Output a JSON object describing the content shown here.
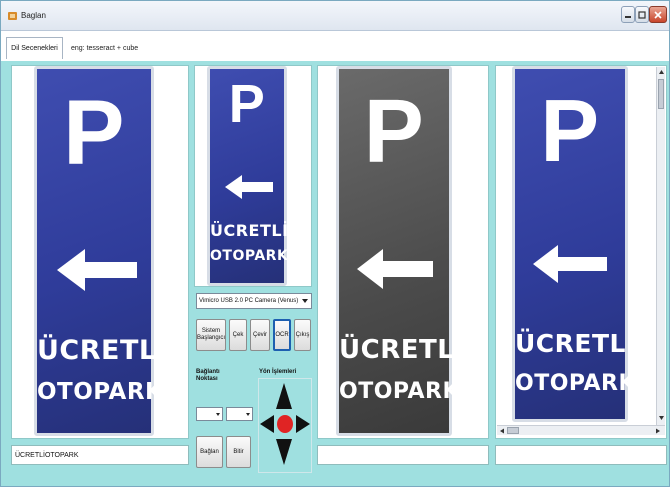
{
  "window": {
    "title": "Baglan"
  },
  "tabs": [
    {
      "label": "Dil Secenekleri"
    }
  ],
  "engine_label": "eng: tesseract + cube",
  "sign": {
    "line1": "P",
    "line2": "ÜCRETLİ",
    "line3": "OTOPARK"
  },
  "camera_select": {
    "value": "Vimicro USB 2.0 PC Camera (Venus)"
  },
  "buttons": {
    "system_start": {
      "line1": "Sistem",
      "line2": "Başlangıcı"
    },
    "capture": "Çek",
    "rotate": "Çevir",
    "ocr": "OCR",
    "exit": "Çıkış",
    "connect": "Bağlan",
    "finish": "Bitir"
  },
  "connection_group": {
    "line1": "Bağlantı",
    "line2": "Noktası"
  },
  "direction_group": {
    "label": "Yön İşlemleri"
  },
  "ocr_result": "ÜCRETLİOTOPARK",
  "colors": {
    "window_bg": "#9fe0e0",
    "sign_blue": "#2f3c9a",
    "center_dot": "#e02424"
  }
}
